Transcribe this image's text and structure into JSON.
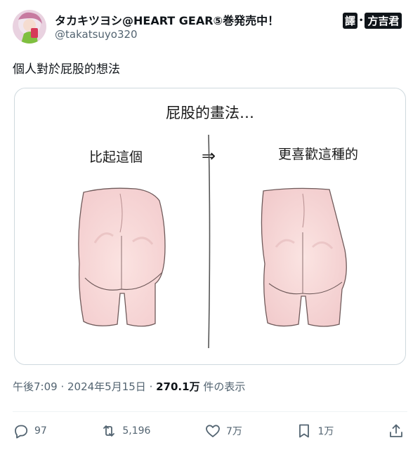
{
  "author": {
    "display_name": "タカキツヨシ@HEART GEAR⑤巻発売中！",
    "handle": "@takatsuyo320"
  },
  "credit": {
    "stamp": "譯",
    "name": "方吉君"
  },
  "tweet": {
    "text": "個人對於屁股的想法"
  },
  "illustration": {
    "title": "屁股的畫法…",
    "left_label": "比起這個",
    "arrow": "⇒",
    "right_label": "更喜歡這種的"
  },
  "meta": {
    "time": "午後7:09",
    "separator1": " · ",
    "date": "2024年5月15日",
    "separator2": " · ",
    "views": "270.1万",
    "views_suffix": " 件の表示"
  },
  "actions": {
    "replies": "97",
    "retweets": "5,196",
    "likes": "7万",
    "bookmarks": "1万"
  },
  "icons": [
    "reply-icon",
    "retweet-icon",
    "like-icon",
    "bookmark-icon",
    "share-icon"
  ]
}
